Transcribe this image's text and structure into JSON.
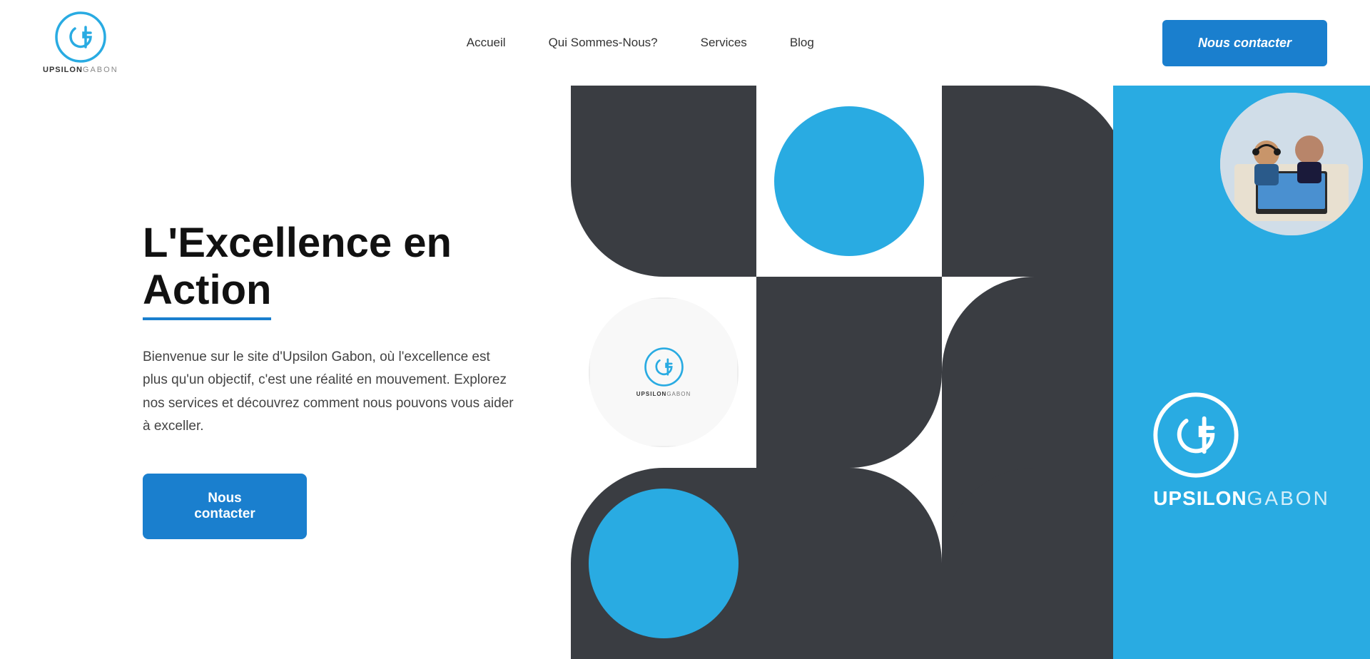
{
  "navbar": {
    "logo_brand": "UPSILON",
    "logo_sub": "GABON",
    "nav_items": [
      {
        "label": "Accueil",
        "id": "accueil"
      },
      {
        "label": "Qui Sommes-Nous?",
        "id": "qui-sommes-nous"
      },
      {
        "label": "Services",
        "id": "services"
      },
      {
        "label": "Blog",
        "id": "blog"
      }
    ],
    "cta_label": "Nous contacter"
  },
  "hero": {
    "title_line1": "L'Excellence en",
    "title_line2": "Action",
    "description": "Bienvenue sur le site d'Upsilon Gabon, où l'excellence est plus qu'un objectif, c'est une réalité en mouvement. Explorez nos services et découvrez comment nous pouvons vous aider à exceller.",
    "cta_label": "Nous contacter"
  },
  "brand": {
    "name_bold": "UPSILON",
    "name_light": "GABON",
    "colors": {
      "blue": "#29abe2",
      "dark": "#3a3d42",
      "white": "#ffffff"
    }
  }
}
